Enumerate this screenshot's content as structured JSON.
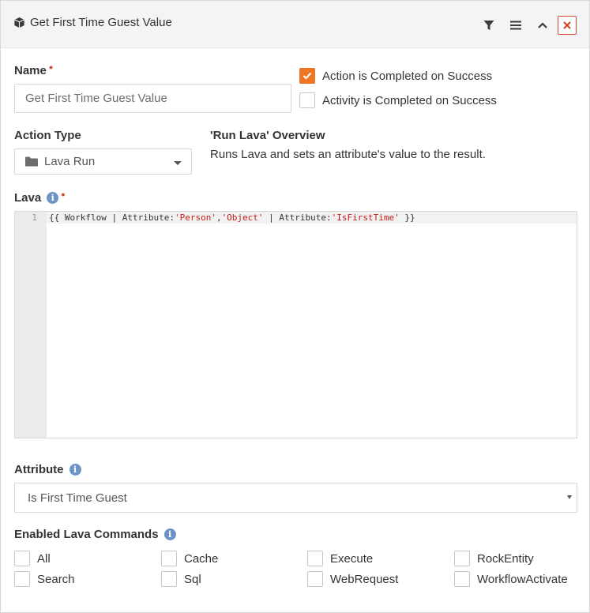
{
  "header": {
    "title": "Get First Time Guest Value",
    "icons": [
      "cube-icon",
      "filter-icon",
      "menu-icon",
      "chevron-up-icon",
      "close-icon"
    ]
  },
  "name_field": {
    "label": "Name",
    "value": "Get First Time Guest Value"
  },
  "checkboxes": {
    "action_completed": {
      "label": "Action is Completed on Success",
      "checked": true
    },
    "activity_completed": {
      "label": "Activity is Completed on Success",
      "checked": false
    }
  },
  "action_type": {
    "label": "Action Type",
    "value": "Lava Run",
    "icon": "folder-icon"
  },
  "overview": {
    "title": "'Run Lava' Overview",
    "text": "Runs Lava and sets an attribute's value to the result."
  },
  "lava": {
    "label": "Lava",
    "line_number": "1",
    "code_parts": {
      "p1": "{{ Workflow | Attribute:",
      "s1": "'Person'",
      "p2": ",",
      "s2": "'Object'",
      "p3": " | Attribute:",
      "s3": "'IsFirstTime'",
      "p4": " }}"
    }
  },
  "attribute": {
    "label": "Attribute",
    "value": "Is First Time Guest"
  },
  "lava_commands": {
    "label": "Enabled Lava Commands",
    "items": [
      "All",
      "Cache",
      "Execute",
      "RockEntity",
      "Search",
      "Sql",
      "WebRequest",
      "WorkflowActivate"
    ]
  },
  "colors": {
    "accent_checkbox": "#ee7625",
    "required": "#d4442e",
    "info": "#6e94c7",
    "code_string": "#c41a16"
  }
}
